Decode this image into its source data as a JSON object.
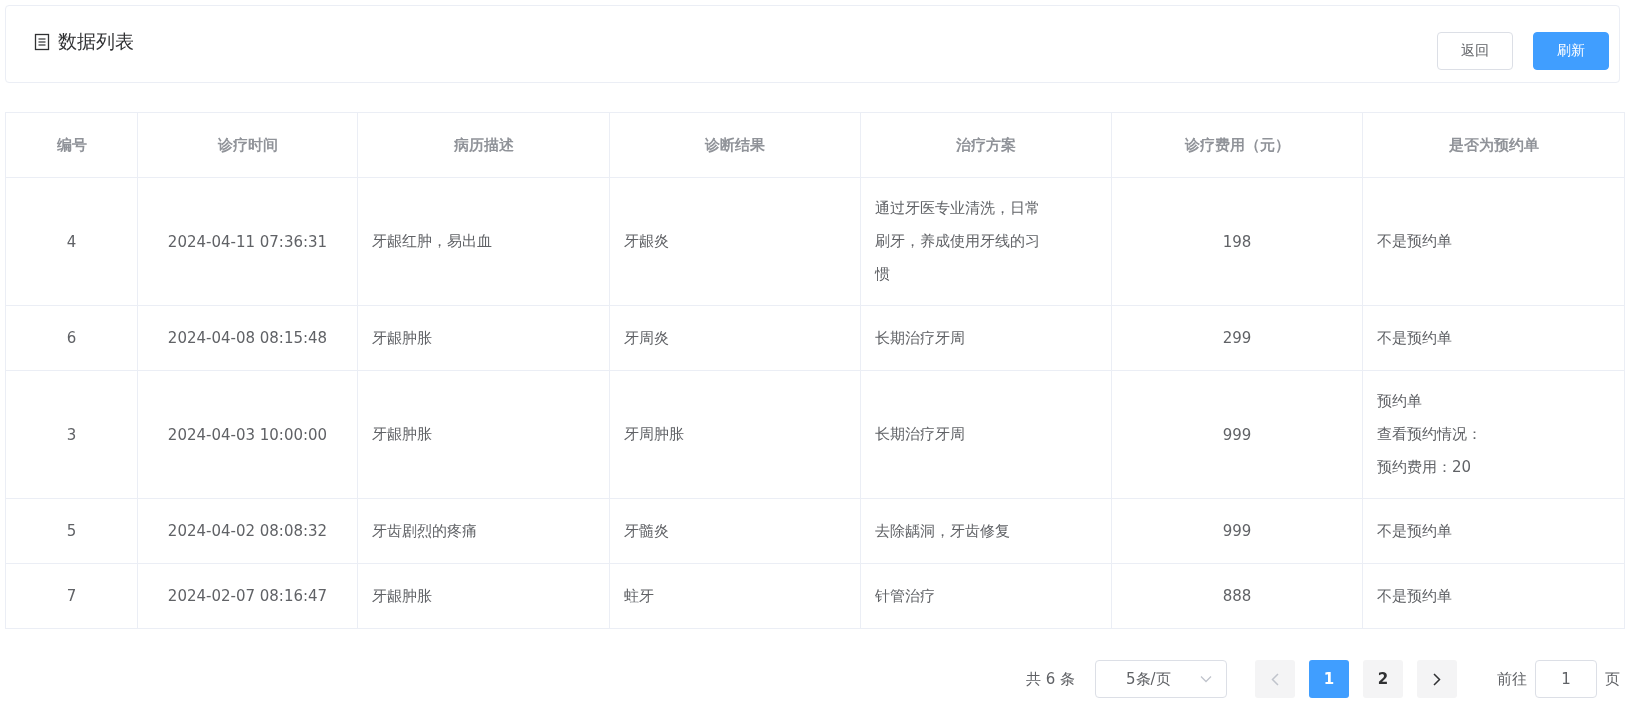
{
  "header": {
    "title": "数据列表",
    "buttons": [
      {
        "label": "返回",
        "kind": "default"
      },
      {
        "label": "刷新",
        "kind": "primary"
      }
    ]
  },
  "table": {
    "columns": [
      "编号",
      "诊疗时间",
      "病历描述",
      "诊断结果",
      "治疗方案",
      "诊疗费用（元）",
      "是否为预约单"
    ],
    "rows": [
      {
        "id": "4",
        "time": "2024-04-11 07:36:31",
        "description": "牙龈红肿，易出血",
        "diagnosis": "牙龈炎",
        "treatment": "通过牙医专业清洗，日常刷牙，养成使用牙线的习惯",
        "fee": "198",
        "appointment": [
          "不是预约单"
        ]
      },
      {
        "id": "6",
        "time": "2024-04-08 08:15:48",
        "description": "牙龈肿胀",
        "diagnosis": "牙周炎",
        "treatment": "长期治疗牙周",
        "fee": "299",
        "appointment": [
          "不是预约单"
        ]
      },
      {
        "id": "3",
        "time": "2024-04-03 10:00:00",
        "description": "牙龈肿胀",
        "diagnosis": "牙周肿胀",
        "treatment": "长期治疗牙周",
        "fee": "999",
        "appointment": [
          "预约单",
          "查看预约情况：",
          "预约费用：20"
        ]
      },
      {
        "id": "5",
        "time": "2024-04-02 08:08:32",
        "description": "牙齿剧烈的疼痛",
        "diagnosis": "牙髓炎",
        "treatment": "去除龋洞，牙齿修复",
        "fee": "999",
        "appointment": [
          "不是预约单"
        ]
      },
      {
        "id": "7",
        "time": "2024-02-07 08:16:47",
        "description": "牙龈肿胀",
        "diagnosis": "蛀牙",
        "treatment": "针管治疗",
        "fee": "888",
        "appointment": [
          "不是预约单"
        ]
      }
    ]
  },
  "pagination": {
    "total": "共 6 条",
    "page_size": "5条/页",
    "pages": [
      {
        "label": "1",
        "selected": true
      },
      {
        "label": "2",
        "selected": false
      }
    ],
    "goto_label": "前往",
    "goto_value": "1",
    "goto_suffix": "页"
  }
}
